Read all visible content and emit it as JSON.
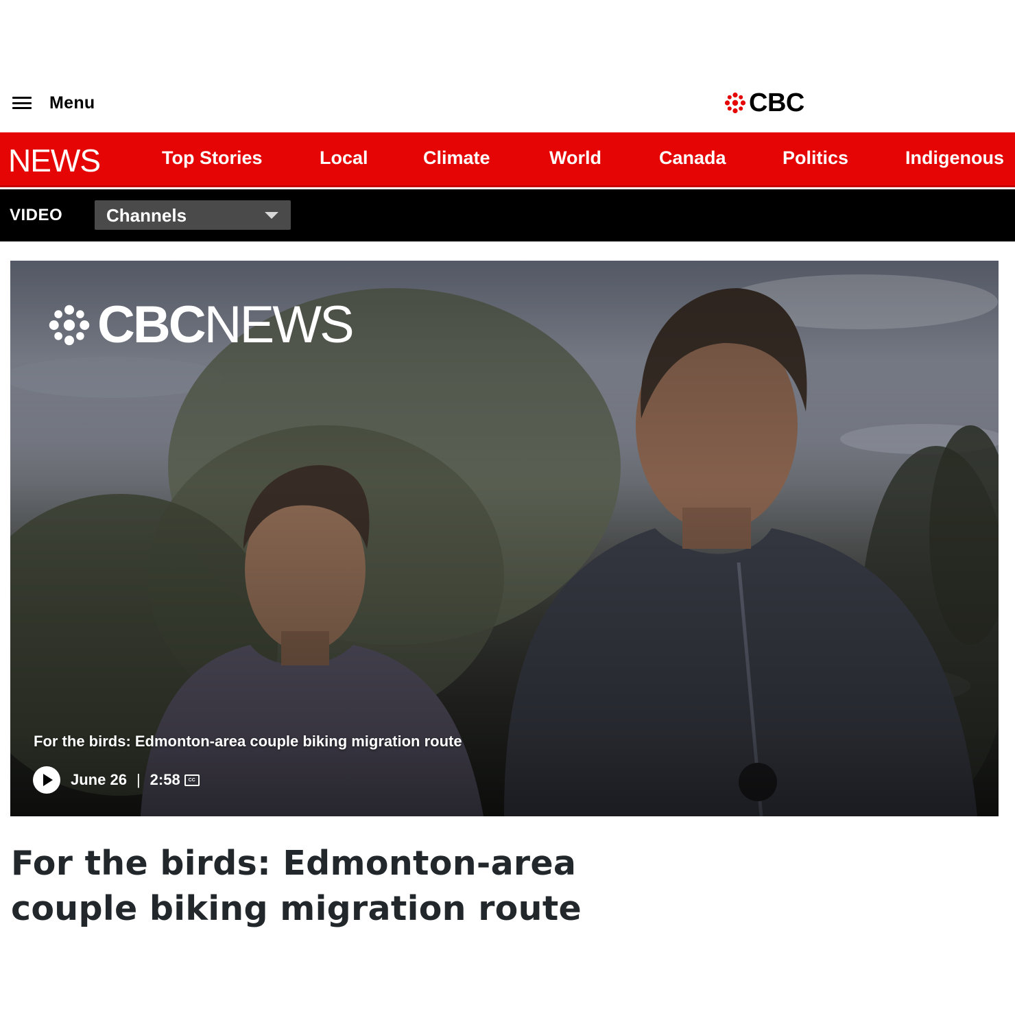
{
  "header": {
    "menu_label": "Menu",
    "logo_text": "CBC"
  },
  "news_nav": {
    "section_logo": "NEWS",
    "items": [
      {
        "label": "Top Stories"
      },
      {
        "label": "Local"
      },
      {
        "label": "Climate"
      },
      {
        "label": "World"
      },
      {
        "label": "Canada"
      },
      {
        "label": "Politics"
      },
      {
        "label": "Indigenous"
      }
    ]
  },
  "video_bar": {
    "label": "VIDEO",
    "channels_selected": "Channels"
  },
  "player": {
    "brand_cbc": "CBC",
    "brand_news": "NEWS",
    "title": "For the birds: Edmonton-area couple biking migration route",
    "date": "June 26",
    "separator": "|",
    "duration": "2:58",
    "cc_label": "CC"
  },
  "article": {
    "headline": "For the birds: Edmonton-area couple biking migration route"
  },
  "colors": {
    "news_red": "#e60505",
    "video_bar": "#000000",
    "channels_bg": "#4a4a4a",
    "headline": "#22272b"
  },
  "icons": {
    "menu": "hamburger-icon",
    "cbc_gem": "cbc-gem-icon",
    "channels_caret": "chevron-down-icon",
    "play": "play-icon",
    "captions": "closed-captions-icon"
  }
}
